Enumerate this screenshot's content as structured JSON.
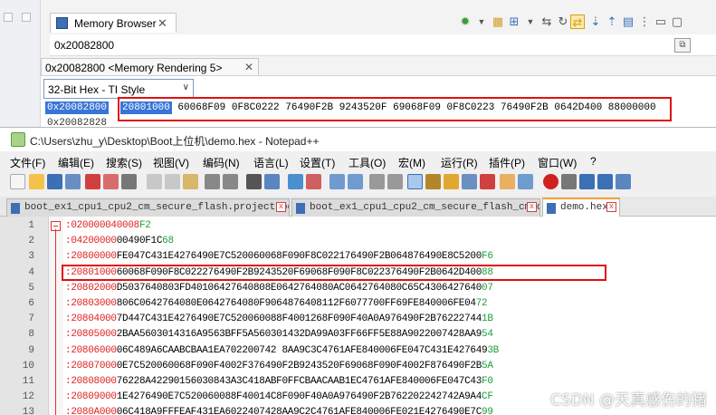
{
  "memory_browser": {
    "view_title": "Memory Browser",
    "address_input": "0x20082800",
    "rendering_tab": "0x20082800 <Memory Rendering 5>",
    "style_select": "32-Bit Hex - TI Style",
    "row_address": "0x20082800",
    "row_address_next": "0x20082828",
    "row_values": [
      "20801000",
      "60068F09",
      "0F8C0222",
      "76490F2B",
      "9243520F",
      "69068F09",
      "0F8C0223",
      "76490F2B",
      "0642D400",
      "88000000"
    ]
  },
  "notepad": {
    "title": "C:\\Users\\zhu_y\\Desktop\\Boot上位机\\demo.hex - Notepad++",
    "menu": [
      "文件(F)",
      "编辑(E)",
      "搜索(S)",
      "视图(V)",
      "编码(N)",
      "语言(L)",
      "设置(T)",
      "工具(O)",
      "宏(M)",
      "运行(R)",
      "插件(P)",
      "窗口(W)",
      "?"
    ],
    "tabs": [
      {
        "label": "boot_ex1_cpu1_cpu2_cm_secure_flash.projectspec"
      },
      {
        "label": "boot_ex1_cpu1_cpu2_cm_secure_flash_cm.c"
      },
      {
        "label": "demo.hex"
      }
    ],
    "lines": [
      {
        "num": "1",
        "colon": ":",
        "hdr": "020000040008",
        "data": "",
        "sum": "F2"
      },
      {
        "num": "2",
        "colon": ":",
        "hdr": "04200000",
        "data": "00490F1C",
        "sum": "68"
      },
      {
        "num": "3",
        "colon": ":",
        "hdr": "20800000",
        "data": "FE047C431E4276490E7C520060068F090F8C022176490F2B064876490E8C5200",
        "sum": "F6"
      },
      {
        "num": "4",
        "colon": ":",
        "hdr": "20801000",
        "data": "60068F090F8C022276490F2B9243520F69068F090F8C022376490F2B0642D400",
        "sum": "88"
      },
      {
        "num": "5",
        "colon": ":",
        "hdr": "20802000",
        "data": "D5037640803FD40106427640808E0642764080AC0642764080C65C4306427640",
        "sum": "07"
      },
      {
        "num": "6",
        "colon": ":",
        "hdr": "20803000",
        "data": "806C0642764080E0642764080F9064876408112F6077700FF69FE840006FE04",
        "sum": "72"
      },
      {
        "num": "7",
        "colon": ":",
        "hdr": "20804000",
        "data": "7D447C431E4276490E7C520060088F4001268F090F40A0A976490F2B76222744",
        "sum": "1B"
      },
      {
        "num": "8",
        "colon": ":",
        "hdr": "20805000",
        "data": "2BAA5603014316A9563BFF5A560301432DA99A03FF66FF5E88A9022007428AA9",
        "sum": "54"
      },
      {
        "num": "9",
        "colon": ":",
        "hdr": "20806000",
        "data": "06C489A6CAABCBAA1EA702200742 8AA9C3C4761AFE840006FE047C431E427649",
        "sum": "3B"
      },
      {
        "num": "10",
        "colon": ":",
        "hdr": "20807000",
        "data": "0E7C520060068F090F4002F376490F2B9243520F69068F090F4002F876490F2B",
        "sum": "5A"
      },
      {
        "num": "11",
        "colon": ":",
        "hdr": "20808000",
        "data": "76228A42290156030843A3C418ABF0FFCBAACAAB1EC4761AFE840006FE047C43",
        "sum": "F0"
      },
      {
        "num": "12",
        "colon": ":",
        "hdr": "20809000",
        "data": "1E4276490E7C520060088F40014C8F090F40A0A976490F2B762202242742A9A4",
        "sum": "CF"
      },
      {
        "num": "13",
        "colon": ":",
        "hdr": "2080A000",
        "data": "06C418A9FFFEAF431EA6022407428AA9C2C4761AFE840006FE021E4276490E7C",
        "sum": "99"
      }
    ]
  }
}
